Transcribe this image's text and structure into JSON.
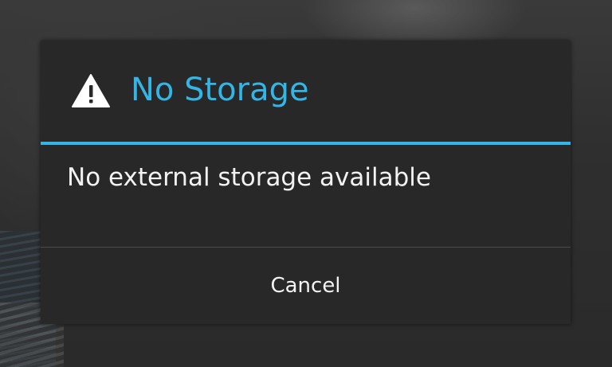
{
  "dialog": {
    "title": "No Storage",
    "icon": "alert-triangle-icon",
    "message": "No external storage available",
    "cancel_label": "Cancel"
  },
  "colors": {
    "accent": "#33b5e5",
    "dialog_background": "#282828",
    "text": "#f2f2f2"
  }
}
